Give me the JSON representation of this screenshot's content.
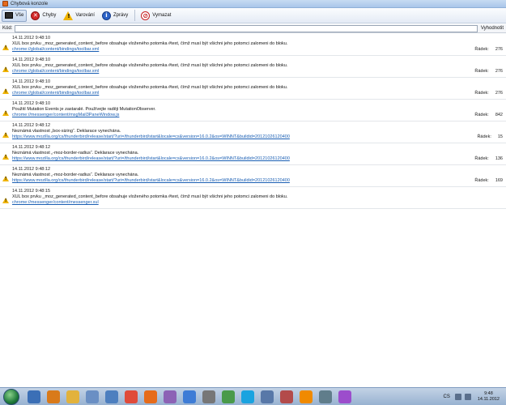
{
  "window": {
    "title": "Chybová konzole"
  },
  "toolbar": {
    "all_label": "Vše",
    "errors_label": "Chyby",
    "warnings_label": "Varování",
    "messages_label": "Zprávy",
    "clear_label": "Vymazat"
  },
  "codebar": {
    "label": "Kód:",
    "value": "",
    "eval_label": "Vyhodnotit"
  },
  "entries": [
    {
      "timestamp": "14.11.2012 9:48:10",
      "message": "XUL box prvku _moz_generated_content_before obsahuje vloženého potomka #text, čímž musí být všichni jeho potomci zalomeni do bloku.",
      "source": "chrome://global/content/bindings/toolbar.xml",
      "line_label": "Řádek:",
      "line": "276"
    },
    {
      "timestamp": "14.11.2012 9:48:10",
      "message": "XUL box prvku _moz_generated_content_before obsahuje vloženého potomka #text, čímž musí být všichni jeho potomci zalomeni do bloku.",
      "source": "chrome://global/content/bindings/toolbar.xml",
      "line_label": "Řádek:",
      "line": "276"
    },
    {
      "timestamp": "14.11.2012 9:48:10",
      "message": "XUL box prvku _moz_generated_content_before obsahuje vloženého potomka #text, čímž musí být všichni jeho potomci zalomeni do bloku.",
      "source": "chrome://global/content/bindings/toolbar.xml",
      "line_label": "Řádek:",
      "line": "276"
    },
    {
      "timestamp": "14.11.2012 9:48:10",
      "message": "Použití Mutation Events je zastaralé. Používejte raději MutationObserver.",
      "source": "chrome://messenger/content/msgMail3PaneWindow.js",
      "line_label": "Řádek:",
      "line": "842"
    },
    {
      "timestamp": "14.11.2012 9:48:12",
      "message": "Neznámá vlastnost „box-sizing“. Deklarace vynechána.",
      "source": "https://www.mozilla.org/cs/thunderbird/release/start/?uri=/thunderbird/start&locale=cs&version=16.0.2&os=WINNT&buildid=20121026120400",
      "line_label": "Řádek:",
      "line": "15"
    },
    {
      "timestamp": "14.11.2012 9:48:12",
      "message": "Neznámá vlastnost „-moz-border-radius“. Deklarace vynechána.",
      "source": "https://www.mozilla.org/cs/thunderbird/release/start/?uri=/thunderbird/start&locale=cs&version=16.0.2&os=WINNT&buildid=20121026120400",
      "line_label": "Řádek:",
      "line": "136"
    },
    {
      "timestamp": "14.11.2012 9:48:12",
      "message": "Neznámá vlastnost „-moz-border-radius“. Deklarace vynechána.",
      "source": "https://www.mozilla.org/cs/thunderbird/release/start/?uri=/thunderbird/start&locale=cs&version=16.0.2&os=WINNT&buildid=20121026120400",
      "line_label": "Řádek:",
      "line": "169"
    },
    {
      "timestamp": "14.11.2012 9:48:15",
      "message": "XUL box prvku _moz_generated_content_before obsahuje vloženého potomka #text, čímž musí být všichni jeho potomci zalomeni do bloku.",
      "source": "chrome://messenger/content/messenger.xul",
      "line_label": "",
      "line": ""
    }
  ],
  "taskbar": {
    "language": "CS",
    "time": "9:48",
    "date": "14.11.2012",
    "icons": [
      "explorer-icon",
      "media-icon",
      "folder-icon",
      "paint-icon",
      "app-icon",
      "chrome-icon",
      "firefox-icon",
      "app-icon",
      "thunderbird-icon",
      "app-icon",
      "app-icon",
      "skype-icon",
      "app-icon",
      "app-icon",
      "vlc-icon",
      "app-icon",
      "app-icon"
    ]
  },
  "colors": {
    "accent": "#2b62c8",
    "link": "#1a5fb4",
    "warning": "#f0b400",
    "error": "#d42a2a"
  }
}
